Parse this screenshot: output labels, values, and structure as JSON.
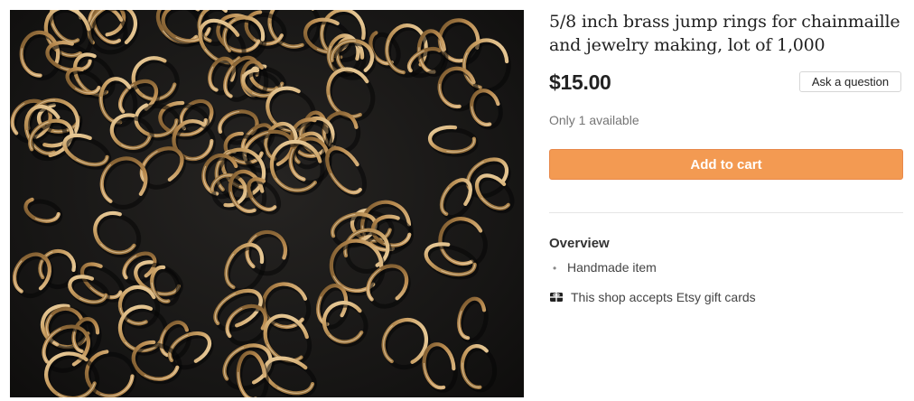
{
  "listing": {
    "title": "5/8 inch brass jump rings for chainmaille and jewelry making, lot of 1,000",
    "price": "$15.00",
    "ask_question_label": "Ask a question",
    "availability": "Only 1 available",
    "add_to_cart_label": "Add to cart"
  },
  "overview": {
    "heading": "Overview",
    "items": [
      "Handmade item"
    ],
    "gift_card_text": "This shop accepts Etsy gift cards",
    "gift_card_icon": "gift-card-icon"
  },
  "colors": {
    "add_to_cart_bg": "#f39a52",
    "text_primary": "#222222",
    "text_muted": "#757575"
  }
}
